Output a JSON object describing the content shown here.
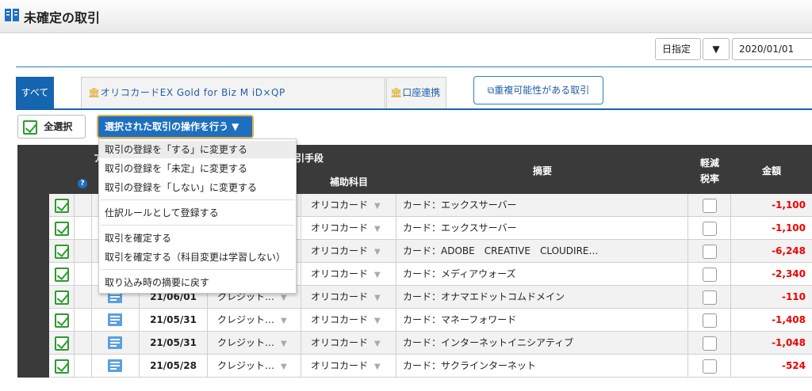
{
  "header": {
    "title": "未確定の取引"
  },
  "date_filter": {
    "mode": "日指定",
    "date": "2020/01/01"
  },
  "tabs": [
    {
      "label": "すべて"
    },
    {
      "label": "オリコカードEX Gold for Biz M iD×QP"
    },
    {
      "label": "口座連携"
    }
  ],
  "duplicate_button": "重複可能性がある取引",
  "toolbar": {
    "select_all": "全選択",
    "operations": "選択された取引の操作を行う ▼"
  },
  "menu": {
    "items": [
      "取引の登録を「する」に変更する",
      "取引の登録を「未定」に変更する",
      "取引の登録を「しない」に変更する",
      "仕訳ルールとして登録する",
      "取引を確定する",
      "取引を確定する（科目変更は学習しない）",
      "取り込み時の摘要に戻す"
    ]
  },
  "table": {
    "headers": {
      "action_partial": "ア",
      "payment_partial": "引手段",
      "sub_account": "補助科目",
      "memo": "摘要",
      "tax_line1": "軽減",
      "tax_line2": "税率",
      "amount": "金額"
    },
    "rows": [
      {
        "date": "",
        "type": "",
        "sub": "オリコカード",
        "memo": "カード：エックスサーバー",
        "amount": "-1,100"
      },
      {
        "date": "",
        "type": "",
        "sub": "オリコカード",
        "memo": "カード：エックスサーバー",
        "amount": "-1,100"
      },
      {
        "date": "",
        "type": "",
        "sub": "オリコカード",
        "memo": "カード：ADOBE　CREATIVE　CLOUDIRE…",
        "amount": "-6,248"
      },
      {
        "date": "",
        "type": "",
        "sub": "オリコカード",
        "memo": "カード：メディアウォーズ",
        "amount": "-2,340"
      },
      {
        "date": "21/06/01",
        "type": "クレジット…",
        "sub": "オリコカード",
        "memo": "カード：オナマエドットコムドメイン",
        "amount": "-110"
      },
      {
        "date": "21/05/31",
        "type": "クレジット…",
        "sub": "オリコカード",
        "memo": "カード：マネーフォワード",
        "amount": "-1,408"
      },
      {
        "date": "21/05/31",
        "type": "クレジット…",
        "sub": "オリコカード",
        "memo": "カード：インターネットイニシアティブ",
        "amount": "-1,048"
      },
      {
        "date": "21/05/28",
        "type": "クレジット…",
        "sub": "オリコカード",
        "memo": "カード：サクラインターネット",
        "amount": "-524"
      }
    ]
  }
}
